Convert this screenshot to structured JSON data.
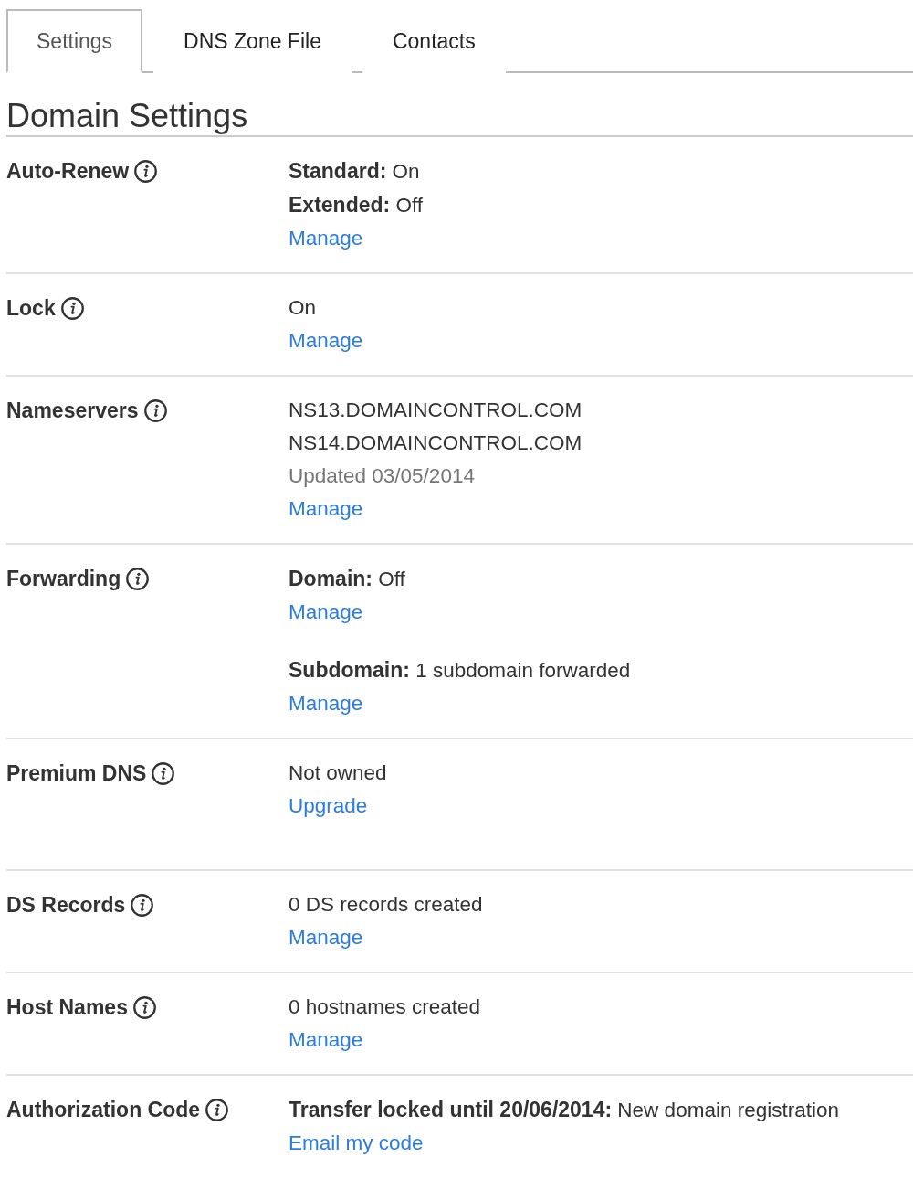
{
  "tabs": [
    {
      "label": "Settings",
      "selected": true
    },
    {
      "label": "DNS Zone File",
      "selected": false
    },
    {
      "label": "Contacts",
      "selected": false
    }
  ],
  "heading": "Domain Settings",
  "settings": [
    {
      "label": "Auto-Renew",
      "groups": [
        [
          {
            "kind": "text",
            "text": "**Standard:** On"
          },
          {
            "kind": "text",
            "text": "**Extended:** Off"
          },
          {
            "kind": "link",
            "text": "Manage"
          }
        ]
      ]
    },
    {
      "label": "Lock",
      "groups": [
        [
          {
            "kind": "text",
            "text": "On"
          },
          {
            "kind": "link",
            "text": "Manage"
          }
        ]
      ]
    },
    {
      "label": "Nameservers",
      "groups": [
        [
          {
            "kind": "text",
            "text": "NS13.DOMAINCONTROL.COM"
          },
          {
            "kind": "text",
            "text": "NS14.DOMAINCONTROL.COM"
          },
          {
            "kind": "note",
            "text": "Updated 03/05/2014"
          },
          {
            "kind": "link",
            "text": "Manage"
          }
        ]
      ]
    },
    {
      "label": "Forwarding",
      "groups": [
        [
          {
            "kind": "text",
            "text": "**Domain:** Off"
          },
          {
            "kind": "link",
            "text": "Manage"
          }
        ],
        [
          {
            "kind": "text",
            "text": "**Subdomain:** 1 subdomain forwarded"
          },
          {
            "kind": "link",
            "text": "Manage"
          }
        ]
      ]
    },
    {
      "label": "Premium DNS",
      "groups": [
        [
          {
            "kind": "text",
            "text": "Not owned"
          },
          {
            "kind": "upgrade_link",
            "text": "Upgrade"
          }
        ]
      ]
    },
    {
      "label": "DS Records",
      "groups": [
        [
          {
            "kind": "text",
            "text": "0 DS records created"
          },
          {
            "kind": "link",
            "text": "Manage"
          }
        ]
      ]
    },
    {
      "label": "Host Names",
      "groups": [
        [
          {
            "kind": "text",
            "text": "0 hostnames created"
          },
          {
            "kind": "link",
            "text": "Manage"
          }
        ]
      ]
    },
    {
      "label": "Authorization Code",
      "groups": [
        [
          {
            "kind": "text",
            "text": "**Transfer locked until 20/06/2014:** New domain registration"
          },
          {
            "kind": "link",
            "text": "Email my code"
          }
        ]
      ]
    }
  ]
}
